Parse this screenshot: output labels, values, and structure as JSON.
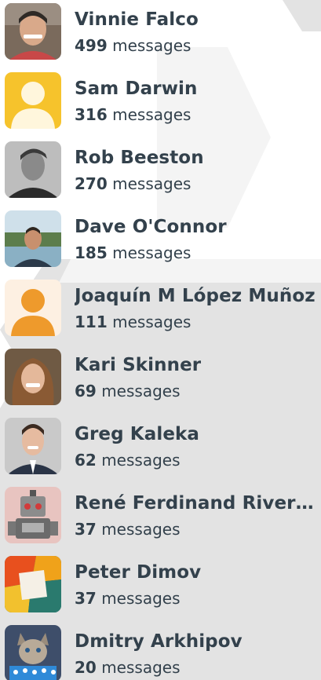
{
  "colors": {
    "text": "#33414c",
    "background": "#ffffff",
    "decor_gray": "#e3e3e3",
    "yellow_avatar_bg": "#f6c32c",
    "orange_avatar_bg": "#fdf0e2",
    "orange_avatar_fg": "#ee9a2c"
  },
  "contributors": [
    {
      "name": "Vinnie Falco",
      "count": "499",
      "unit": "messages",
      "avatar": "photo-man-smiling"
    },
    {
      "name": "Sam Darwin",
      "count": "316",
      "unit": "messages",
      "avatar": "default-user-icon-yellow"
    },
    {
      "name": "Rob Beeston",
      "count": "270",
      "unit": "messages",
      "avatar": "photo-man-grayscale"
    },
    {
      "name": "Dave O'Connor",
      "count": "185",
      "unit": "messages",
      "avatar": "photo-man-outdoors"
    },
    {
      "name": "Joaquín M López Muñoz",
      "count": "111",
      "unit": "messages",
      "avatar": "default-user-icon-orange"
    },
    {
      "name": "Kari Skinner",
      "count": "69",
      "unit": "messages",
      "avatar": "photo-woman-smiling"
    },
    {
      "name": "Greg Kaleka",
      "count": "62",
      "unit": "messages",
      "avatar": "photo-man-suit"
    },
    {
      "name": "René Ferdinand Rivera ...",
      "count": "37",
      "unit": "messages",
      "avatar": "robot-toy-icon"
    },
    {
      "name": "Peter Dimov",
      "count": "37",
      "unit": "messages",
      "avatar": "colorful-tiles-icon"
    },
    {
      "name": "Dmitry Arkhipov",
      "count": "20",
      "unit": "messages",
      "avatar": "cat-photo"
    }
  ]
}
